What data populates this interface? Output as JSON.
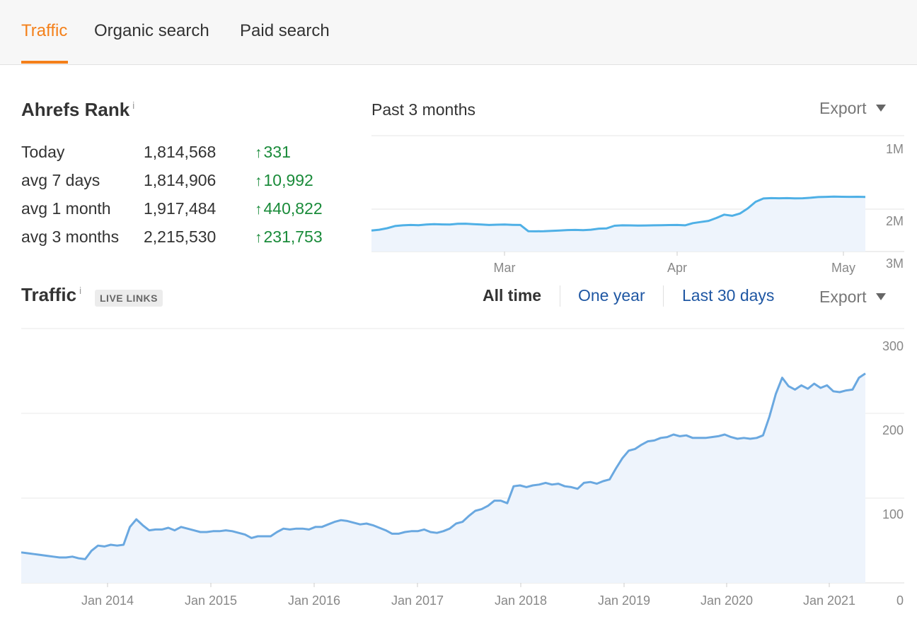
{
  "tabs": [
    {
      "label": "Traffic",
      "active": true
    },
    {
      "label": "Organic search",
      "active": false
    },
    {
      "label": "Paid search",
      "active": false
    }
  ],
  "rank": {
    "title": "Ahrefs Rank",
    "info": "i",
    "rows": [
      {
        "label": "Today",
        "value": "1,814,568",
        "delta": "331"
      },
      {
        "label": "avg 7 days",
        "value": "1,814,906",
        "delta": "10,992"
      },
      {
        "label": "avg 1 month",
        "value": "1,917,484",
        "delta": "440,822"
      },
      {
        "label": "avg 3 months",
        "value": "2,215,530",
        "delta": "231,753"
      }
    ],
    "delta_arrow": "↑",
    "period": "Past 3 months",
    "export": "Export"
  },
  "traffic": {
    "title": "Traffic",
    "info": "i",
    "badge": "LIVE LINKS",
    "ranges": [
      "All time",
      "One year",
      "Last 30 days"
    ],
    "active_range": "All time",
    "export": "Export"
  },
  "colors": {
    "accent": "#f4801a",
    "link": "#1f57a3",
    "positive": "#1a8b3a",
    "rank_line": "#4fb0e6",
    "traffic_line": "#6aa8e0",
    "area_fill": "#eef4fc"
  },
  "chart_data": [
    {
      "type": "area",
      "title": "Past 3 months",
      "y_reversed": true,
      "y_ticks": [
        "1M",
        "2M",
        "3M"
      ],
      "x_ticks": [
        "Mar",
        "Apr",
        "May"
      ],
      "ylim": [
        1000000,
        3000000
      ],
      "series": [
        {
          "values": [
            2290000,
            2280000,
            2260000,
            2230000,
            2220000,
            2215000,
            2218000,
            2210000,
            2205000,
            2208000,
            2210000,
            2200000,
            2198000,
            2205000,
            2210000,
            2215000,
            2212000,
            2210000,
            2213000,
            2215000,
            2300000,
            2302000,
            2300000,
            2295000,
            2290000,
            2285000,
            2283000,
            2286000,
            2280000,
            2265000,
            2262000,
            2226000,
            2220000,
            2221000,
            2224000,
            2222000,
            2220000,
            2218000,
            2216000,
            2215000,
            2220000,
            2190000,
            2175000,
            2160000,
            2120000,
            2075000,
            2090000,
            2060000,
            1990000,
            1900000,
            1855000,
            1850000,
            1852000,
            1850000,
            1853000,
            1852000,
            1845000,
            1836000,
            1833000,
            1830000,
            1832000,
            1833000,
            1832000,
            1835000
          ]
        }
      ]
    },
    {
      "type": "area",
      "y_ticks": [
        0,
        100,
        200,
        300
      ],
      "ylim": [
        0,
        300
      ],
      "x_ticks": [
        "Jan 2014",
        "Jan 2015",
        "Jan 2016",
        "Jan 2017",
        "Jan 2018",
        "Jan 2019",
        "Jan 2020",
        "Jan 2021"
      ],
      "x_range": [
        "2013-03",
        "2021-04"
      ],
      "series": [
        {
          "values": [
            36,
            35,
            34,
            33,
            32,
            31,
            30,
            30,
            31,
            29,
            28,
            38,
            44,
            43,
            45,
            44,
            45,
            66,
            75,
            68,
            62,
            63,
            63,
            65,
            62,
            66,
            64,
            62,
            60,
            60,
            61,
            61,
            62,
            61,
            59,
            57,
            53,
            55,
            55,
            55,
            60,
            64,
            63,
            64,
            64,
            63,
            66,
            66,
            69,
            72,
            74,
            73,
            71,
            69,
            70,
            68,
            65,
            62,
            58,
            58,
            60,
            61,
            61,
            63,
            60,
            59,
            61,
            64,
            70,
            72,
            79,
            85,
            87,
            91,
            97,
            97,
            94,
            114,
            115,
            113,
            115,
            116,
            118,
            116,
            117,
            114,
            113,
            111,
            118,
            119,
            117,
            120,
            122,
            135,
            147,
            156,
            158,
            163,
            167,
            168,
            171,
            172,
            175,
            173,
            174,
            171,
            171,
            171,
            172,
            173,
            175,
            172,
            170,
            171,
            170,
            171,
            174,
            196,
            223,
            242,
            232,
            228,
            233,
            229,
            235,
            230,
            233,
            226,
            225,
            227,
            228,
            242,
            247
          ]
        }
      ]
    }
  ]
}
